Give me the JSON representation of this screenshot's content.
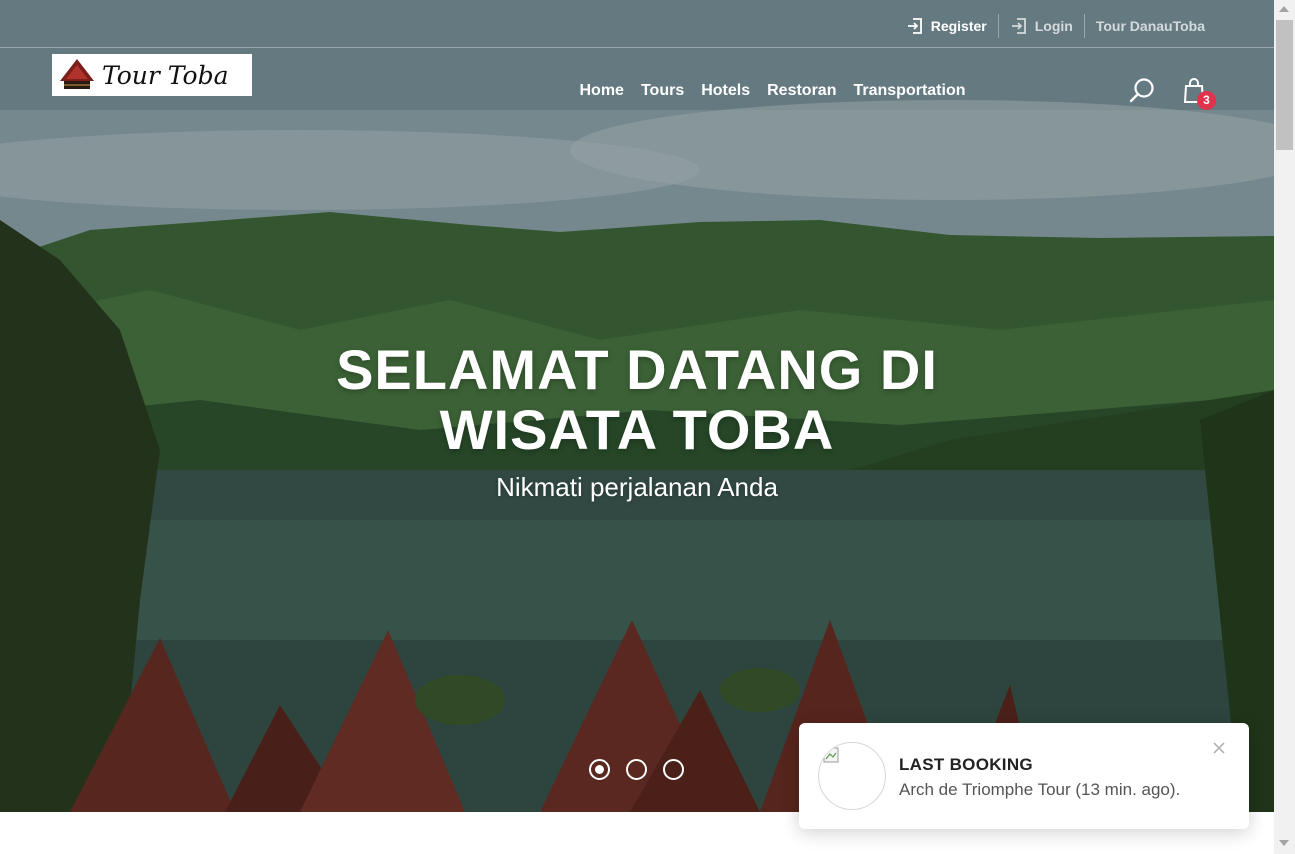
{
  "topbar": {
    "register_label": "Register",
    "login_label": "Login",
    "site_label": "Tour DanauToba"
  },
  "logo": {
    "text": "Tour Toba"
  },
  "nav": {
    "items": [
      {
        "label": "Home"
      },
      {
        "label": "Tours"
      },
      {
        "label": "Hotels"
      },
      {
        "label": "Restoran"
      },
      {
        "label": "Transportation"
      }
    ]
  },
  "cart": {
    "count": "3"
  },
  "hero": {
    "title_line1": "SELAMAT DATANG DI",
    "title_line2": "WISATA TOBA",
    "subtitle": "Nikmati perjalanan Anda",
    "slides_total": 3,
    "active_slide": 1
  },
  "toast": {
    "title": "LAST BOOKING",
    "message": "Arch de Triomphe Tour (13 min. ago)."
  },
  "colors": {
    "badge": "#e0334d",
    "text_on_hero": "#ffffff"
  }
}
